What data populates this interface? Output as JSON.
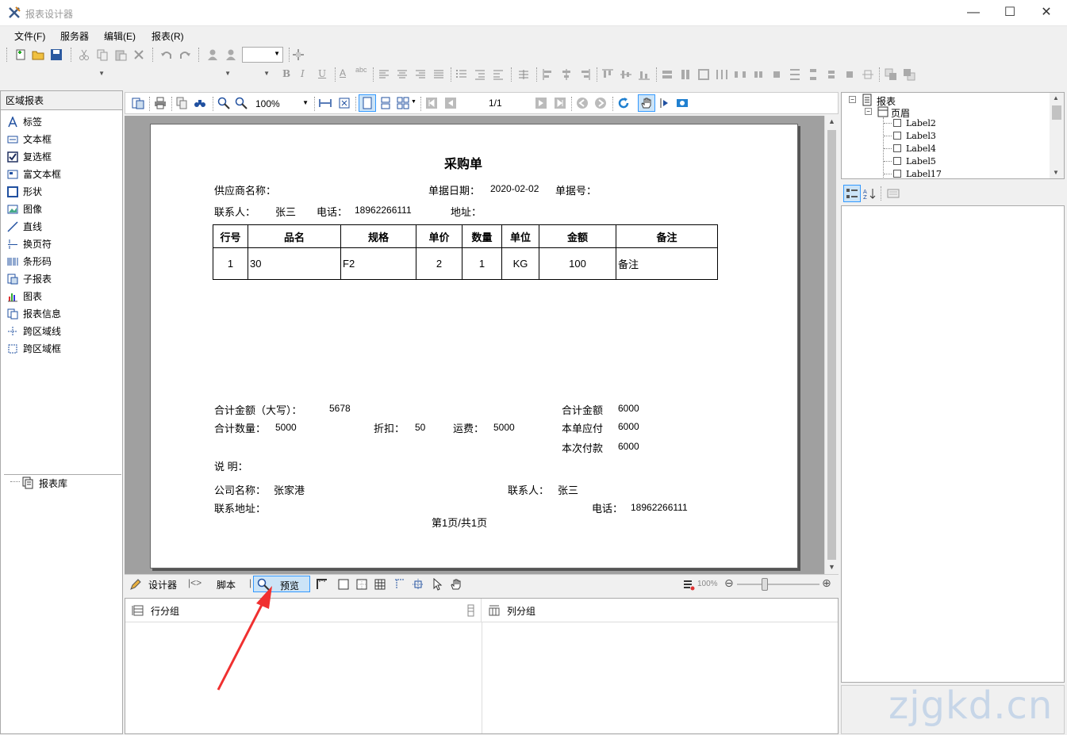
{
  "window": {
    "title": "报表设计器",
    "minimize": "—",
    "maximize": "☐",
    "close": "✕"
  },
  "menu": [
    "文件(F)",
    "服务器",
    "编辑(E)",
    "报表(R)"
  ],
  "left_panel": {
    "header": "区域报表",
    "tools": [
      "标签",
      "文本框",
      "复选框",
      "富文本框",
      "形状",
      "图像",
      "直线",
      "换页符",
      "条形码",
      "子报表",
      "图表",
      "报表信息",
      "跨区域线",
      "跨区域框"
    ],
    "library": "报表库"
  },
  "preview_toolbar": {
    "zoom": "100%",
    "page": "1/1"
  },
  "report": {
    "title": "采购单",
    "supplier_label": "供应商名称：",
    "date_label": "单据日期：",
    "date_value": "2020-02-02",
    "docno_label": "单据号：",
    "contact_label": "联系人：",
    "contact_value": "张三",
    "phone_label": "电话：",
    "phone_value": "18962266111",
    "address_label": "地址：",
    "table_headers": [
      "行号",
      "品名",
      "规格",
      "单价",
      "数量",
      "单位",
      "金额",
      "备注"
    ],
    "table_rows": [
      [
        "1",
        "30",
        "F2",
        "2",
        "1",
        "KG",
        "100",
        "备注"
      ]
    ],
    "total_upper_label": "合计金额（大写）：",
    "total_upper_value": "5678",
    "total_qty_label": "合计数量：",
    "total_qty_value": "5000",
    "discount_label": "折扣：",
    "discount_value": "50",
    "freight_label": "运费：",
    "freight_value": "5000",
    "total_amount_label": "合计金额",
    "total_amount_value": "6000",
    "payable_label": "本单应付",
    "payable_value": "6000",
    "paid_label": "本次付款",
    "paid_value": "6000",
    "notes_label": "说 明：",
    "company_label": "公司名称：",
    "company_value": "张家港",
    "contact2_label": "联系人：",
    "contact2_value": "张三",
    "address2_label": "联系地址：",
    "phone2_label": "电话：",
    "phone2_value": "18962266111",
    "page_footer": "第1页/共1页"
  },
  "tabs": {
    "designer": "设计器",
    "script": "脚本",
    "preview": "预览",
    "zoom": "100%"
  },
  "groups": {
    "rows": "行分组",
    "cols": "列分组"
  },
  "tree": {
    "root": "报表",
    "header": "页眉",
    "labels": [
      "Label2",
      "Label3",
      "Label4",
      "Label5",
      "Label17"
    ]
  },
  "watermark": "zjgkd.cn",
  "colors": {
    "accent": "#3399ff",
    "arrow": "#f03030",
    "selected": "#cce4f7"
  }
}
